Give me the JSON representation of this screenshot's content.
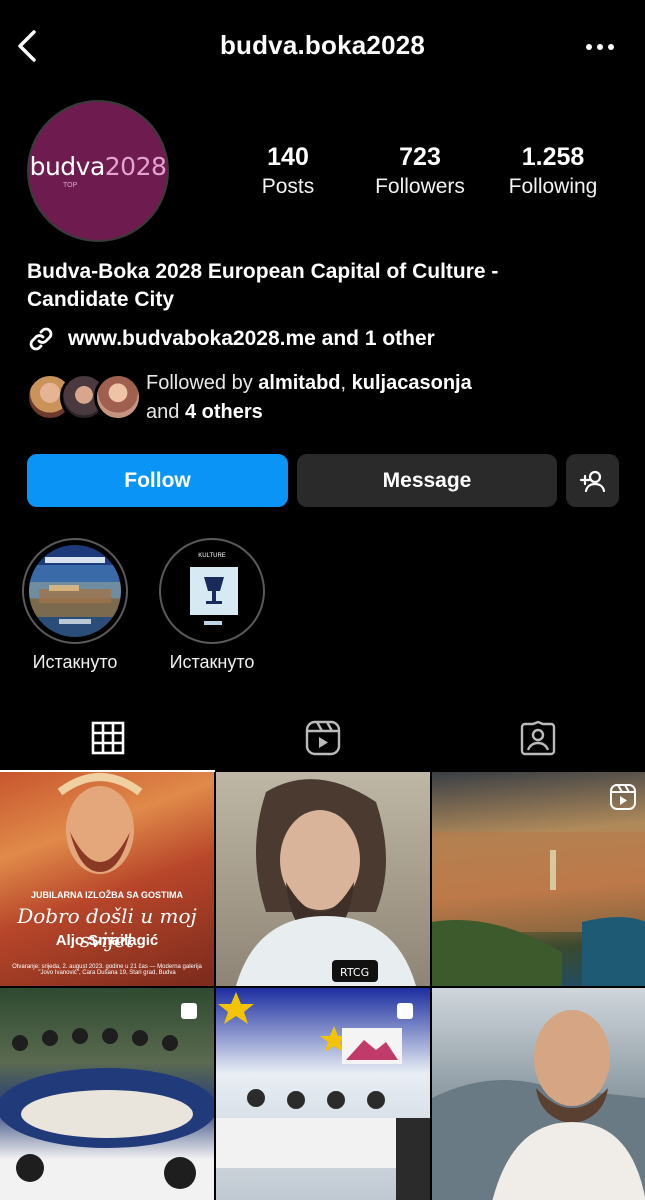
{
  "header": {
    "username": "budva.boka2028",
    "back_icon": "chevron-left-icon",
    "more_icon": "more-horizontal-icon"
  },
  "profile": {
    "avatar": {
      "text_part1": "budva",
      "text_part2": "2028",
      "small_text": "TOP",
      "bg_color": "#6e1c4f"
    },
    "stats": [
      {
        "value": "140",
        "label": "Posts"
      },
      {
        "value": "723",
        "label": "Followers"
      },
      {
        "value": "1.258",
        "label": "Following"
      }
    ],
    "bio_line1": "Budva-Boka 2028 European Capital of Culture -",
    "bio_line2": "Candidate City",
    "link_text": "www.budvaboka2028.me and 1 other",
    "followed_by_prefix": "Followed by ",
    "followed_by_user1": "almitabd",
    "followed_by_sep": ", ",
    "followed_by_user2": "kuljacasonja",
    "followed_by_line2_prefix": "and ",
    "followed_by_others": "4 others"
  },
  "actions": {
    "follow_label": "Follow",
    "message_label": "Message",
    "add_user_icon": "add-user-icon",
    "follow_color": "#0a95f6"
  },
  "highlights": [
    {
      "label": "Истакнуто"
    },
    {
      "label": "Истакнуто",
      "image_text": "KULTURE"
    }
  ],
  "tabs": [
    {
      "name": "grid",
      "icon": "grid-icon",
      "active": true
    },
    {
      "name": "reels",
      "icon": "reels-icon",
      "active": false
    },
    {
      "name": "tagged",
      "icon": "tagged-icon",
      "active": false
    }
  ],
  "posts": [
    {
      "type": "image",
      "subtitle": "JUBILARNA IZLOŽBA SA GOSTIMA",
      "title": "Dobro došli u moj svijet",
      "artist": "Aljo Smailagić",
      "info": "Otvaranje: srijeda, 2. august 2023. godine u 21 čas — Moderna galerija \"Jovo Ivanović\", Cara Dušana 19, Stari grad, Budva"
    },
    {
      "type": "image",
      "badge_text": "RTCG"
    },
    {
      "type": "reel"
    },
    {
      "type": "carousel"
    },
    {
      "type": "carousel"
    },
    {
      "type": "image"
    }
  ]
}
